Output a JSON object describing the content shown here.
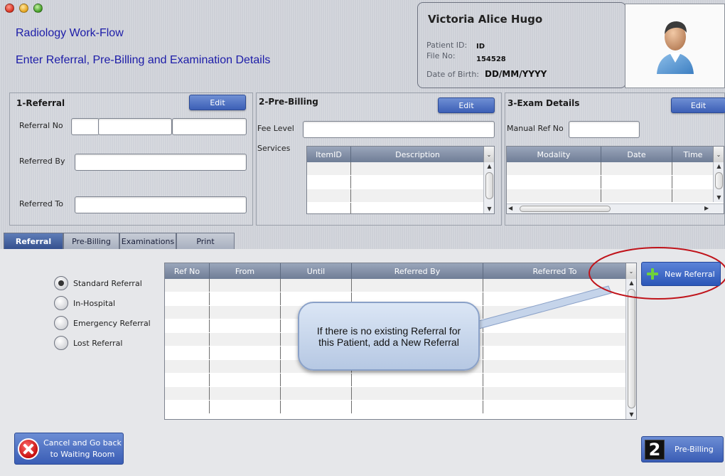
{
  "window": {
    "title": "Radiology Work-Flow",
    "subtitle": "Enter Referral, Pre-Billing and Examination Details"
  },
  "patient": {
    "name": "Victoria Alice Hugo",
    "id_label": "Patient ID:",
    "id_value": "ID",
    "file_label": "File No:",
    "file_value": "154528",
    "dob_label": "Date of Birth:",
    "dob_value": "DD/MM/YYYY",
    "photo_icon": "patient-avatar-icon"
  },
  "referral_panel": {
    "title": "1-Referral",
    "edit_label": "Edit",
    "referral_no_label": "Referral No",
    "referred_by_label": "Referred By",
    "referred_to_label": "Referred  To"
  },
  "prebilling_panel": {
    "title": "2-Pre-Billing",
    "edit_label": "Edit",
    "fee_level_label": "Fee Level",
    "services_label": "Services",
    "columns": [
      "ItemID",
      "Description"
    ]
  },
  "exam_panel": {
    "title": "3-Exam Details",
    "edit_label": "Edit",
    "manual_ref_label": "Manual Ref No",
    "columns": [
      "Modality",
      "Date",
      "Time"
    ]
  },
  "tabs": [
    {
      "label": "Referral",
      "active": true
    },
    {
      "label": "Pre-Billing",
      "active": false
    },
    {
      "label": "Examinations",
      "active": false
    },
    {
      "label": "Print",
      "active": false
    }
  ],
  "referral_types": [
    {
      "label": "Standard Referral",
      "checked": true
    },
    {
      "label": "In-Hospital",
      "checked": false
    },
    {
      "label": "Emergency Referral",
      "checked": false
    },
    {
      "label": "Lost Referral",
      "checked": false
    }
  ],
  "referral_table": {
    "columns": [
      "Ref No",
      "From",
      "Until",
      "Referred By",
      "Referred To"
    ]
  },
  "new_referral_button": {
    "label": "New Referral",
    "icon": "plus-icon"
  },
  "callout": {
    "text": "If there is no existing Referral for this Patient, add a New Referral"
  },
  "cancel_button": {
    "label": "Cancel and Go back to Waiting Room",
    "icon": "close-icon"
  },
  "next_button": {
    "label": "Pre-Billing",
    "step": "2"
  },
  "colors": {
    "accent": "#3c5fb6",
    "title_text": "#1c1ca8",
    "highlight_circle": "#c0141b"
  }
}
